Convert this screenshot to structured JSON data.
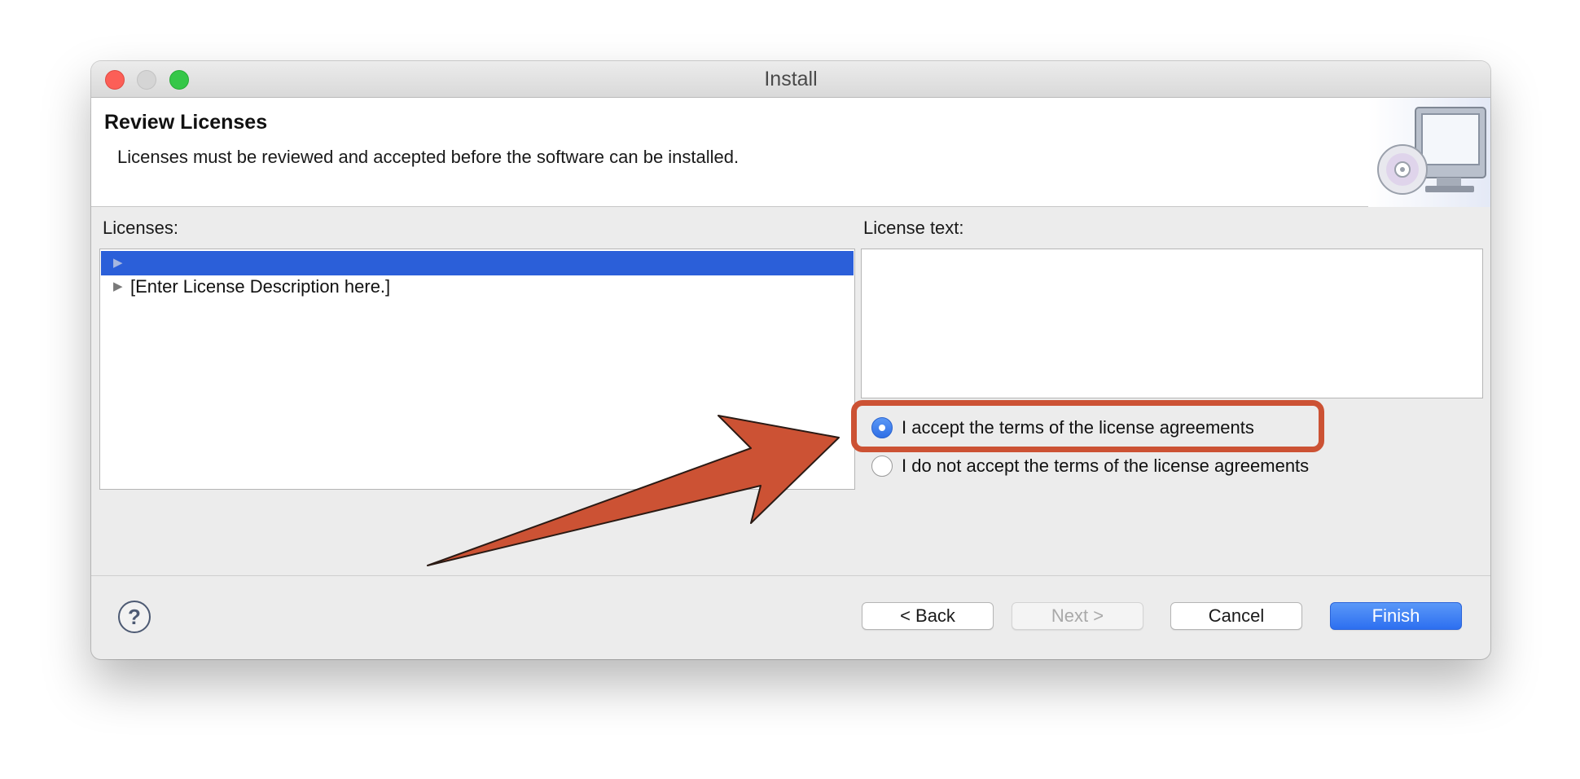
{
  "window": {
    "title": "Install"
  },
  "header": {
    "title": "Review Licenses",
    "description": "Licenses must be reviewed and accepted before the software can be installed.",
    "art_icon": "install-computer-cd-icon"
  },
  "licenses": {
    "label": "Licenses:",
    "items": [
      {
        "label": "",
        "selected": true
      },
      {
        "label": "[Enter License Description here.]",
        "selected": false
      }
    ]
  },
  "license_text": {
    "label": "License text:",
    "value": ""
  },
  "agreement": {
    "accept_label": "I accept the terms of the license agreements",
    "decline_label": "I do not accept the terms of the license agreements",
    "selected": "accept"
  },
  "footer": {
    "help_icon": "question-mark-icon",
    "help_glyph": "?",
    "back_label": "< Back",
    "next_label": "Next >",
    "cancel_label": "Cancel",
    "finish_label": "Finish"
  },
  "colors": {
    "selection": "#2b5fd9",
    "primary_button": "#2d6ff0",
    "annotation": "#cc5234"
  }
}
